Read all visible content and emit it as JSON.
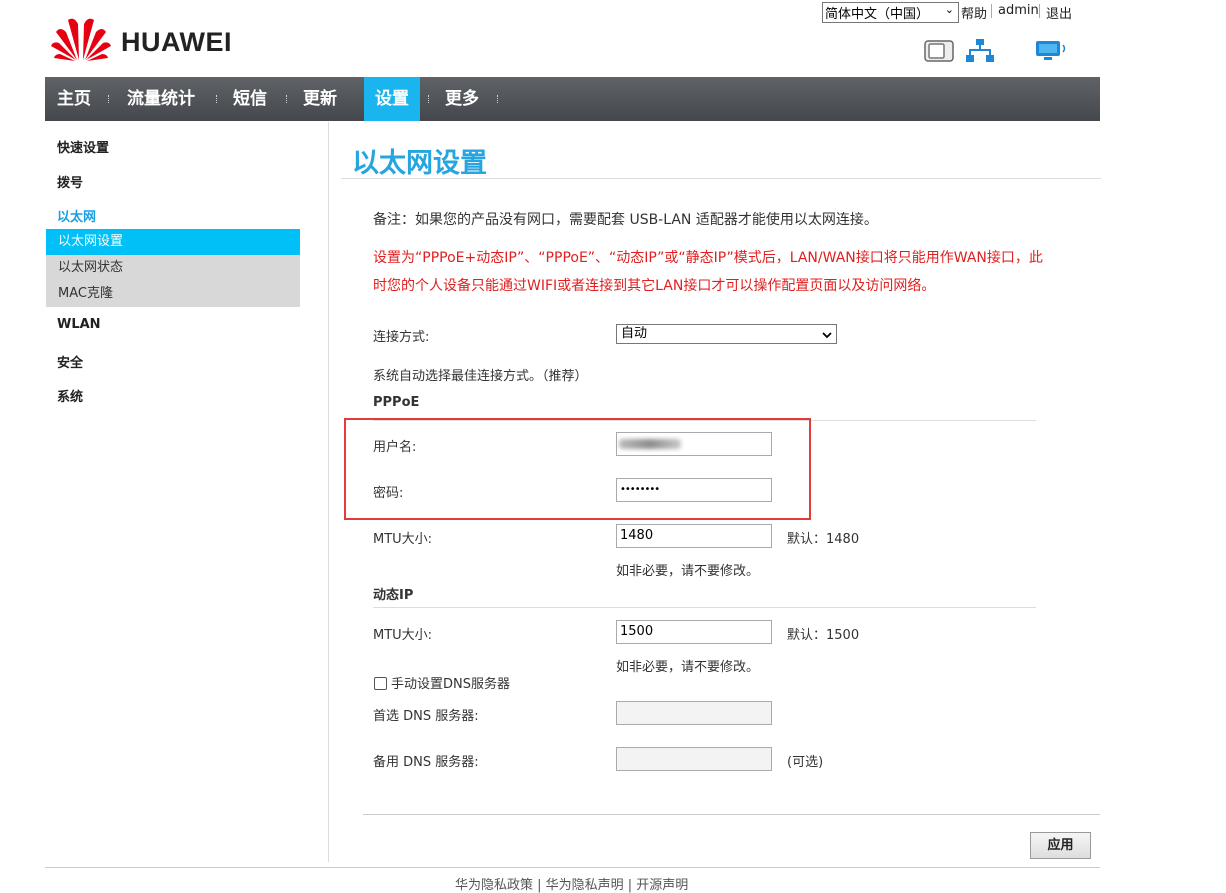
{
  "header": {
    "language": "简体中文（中国）",
    "help": "帮助",
    "user": "admin",
    "logout": "退出",
    "brand": "HUAWEI",
    "brand_color": "#e60012"
  },
  "status_icons": [
    "sim-card-icon",
    "ethernet-network-icon",
    "connected-device-icon"
  ],
  "nav": {
    "items": [
      "主页",
      "流量统计",
      "短信",
      "更新",
      "设置",
      "更多"
    ],
    "active": "设置",
    "accent": "#1ab4ef"
  },
  "sidebar": {
    "quick_setup": "快速设置",
    "dialup": "拨号",
    "ethernet": "以太网",
    "ethernet_sub": [
      "以太网设置",
      "以太网状态",
      "MAC克隆"
    ],
    "wlan": "WLAN",
    "security": "安全",
    "system": "系统"
  },
  "main": {
    "title": "以太网设置",
    "note": "备注：如果您的产品没有网口，需要配套 USB-LAN 适配器才能使用以太网连接。",
    "warning_line1": "设置为“PPPoE+动态IP”、“PPPoE”、“动态IP”或“静态IP”模式后，LAN/WAN接口将只能用作WAN接口，此",
    "warning_line2": "时您的个人设备只能通过WIFI或者连接到其它LAN接口才可以操作配置页面以及访问网络。",
    "connection_mode_label": "连接方式:",
    "connection_mode_value": "自动",
    "connection_mode_desc": "系统自动选择最佳连接方式。（推荐）",
    "pppoe": {
      "title": "PPPoE",
      "username_label": "用户名:",
      "password_label": "密码:",
      "password_value": "••••••••",
      "mtu_label": "MTU大小:",
      "mtu_value": "1480",
      "mtu_default": "默认：1480",
      "mtu_hint": "如非必要，请不要修改。"
    },
    "dynamic_ip": {
      "title": "动态IP",
      "mtu_label": "MTU大小:",
      "mtu_value": "1500",
      "mtu_default": "默认：1500",
      "mtu_hint": "如非必要，请不要修改。",
      "manual_dns_label": "手动设置DNS服务器",
      "primary_dns_label": "首选 DNS 服务器:",
      "secondary_dns_label": "备用 DNS 服务器:",
      "optional": "(可选)"
    },
    "apply": "应用"
  },
  "footer": {
    "text": "华为隐私政策 | 华为隐私声明 | 开源声明"
  }
}
